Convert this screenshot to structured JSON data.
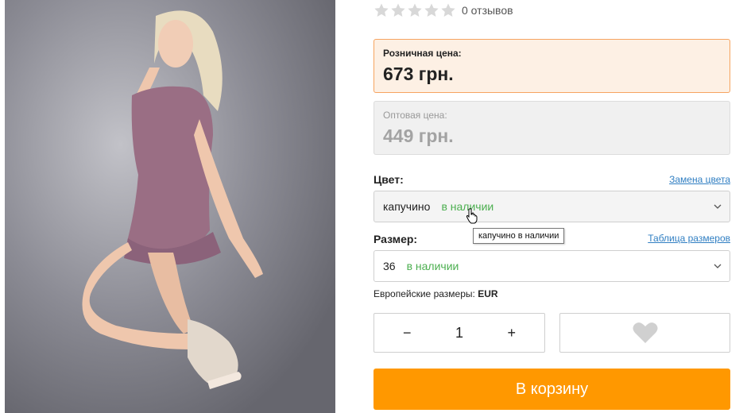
{
  "rating": {
    "stars": 5,
    "filled": 0,
    "reviews_text": "0 отзывов",
    "star_color": "#d8d8d8"
  },
  "retail": {
    "label": "Розничная цена:",
    "value": "673 грн.",
    "border_color": "#f6a460",
    "bg_color": "#fdf0e4"
  },
  "wholesale": {
    "label": "Оптовая цена:",
    "value": "449 грн."
  },
  "color": {
    "label": "Цвет:",
    "link": "Замена цвета",
    "selected": "капучино",
    "availability": "в наличии",
    "tooltip": "капучино в наличии"
  },
  "size": {
    "label": "Размер:",
    "link": "Таблица размеров",
    "selected": "36",
    "availability": "в наличии"
  },
  "euro_sizes": {
    "label": "Европейские размеры:",
    "value": "EUR"
  },
  "quantity": {
    "minus": "−",
    "value": "1",
    "plus": "+"
  },
  "favorite": {
    "icon": "heart-icon",
    "color": "#d0d0d0"
  },
  "cart": {
    "label": "В корзину",
    "color": "#ff9800"
  },
  "availability_color": "#4caf50",
  "link_color": "#2f7ec2"
}
